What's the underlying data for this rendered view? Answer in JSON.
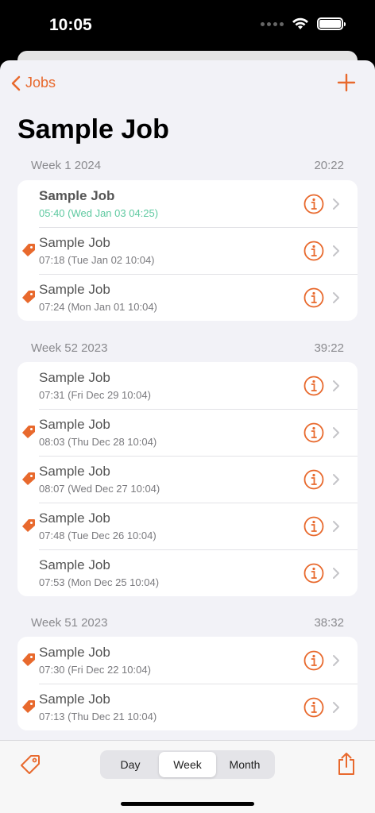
{
  "status": {
    "time": "10:05"
  },
  "nav": {
    "back_label": "Jobs",
    "title": "Sample Job"
  },
  "colors": {
    "accent": "#e8692d",
    "running": "#5ec9a0"
  },
  "sections": [
    {
      "header": "Week 1 2024",
      "total": "20:22",
      "rows": [
        {
          "title": "Sample Job",
          "subtitle": "05:40 (Wed Jan 03 04:25)",
          "tagged": false,
          "running": true
        },
        {
          "title": "Sample Job",
          "subtitle": "07:18 (Tue Jan 02 10:04)",
          "tagged": true,
          "running": false
        },
        {
          "title": "Sample Job",
          "subtitle": "07:24 (Mon Jan 01 10:04)",
          "tagged": true,
          "running": false
        }
      ]
    },
    {
      "header": "Week 52 2023",
      "total": "39:22",
      "rows": [
        {
          "title": "Sample Job",
          "subtitle": "07:31 (Fri Dec 29 10:04)",
          "tagged": false,
          "running": false
        },
        {
          "title": "Sample Job",
          "subtitle": "08:03 (Thu Dec 28 10:04)",
          "tagged": true,
          "running": false
        },
        {
          "title": "Sample Job",
          "subtitle": "08:07 (Wed Dec 27 10:04)",
          "tagged": true,
          "running": false
        },
        {
          "title": "Sample Job",
          "subtitle": "07:48 (Tue Dec 26 10:04)",
          "tagged": true,
          "running": false
        },
        {
          "title": "Sample Job",
          "subtitle": "07:53 (Mon Dec 25 10:04)",
          "tagged": false,
          "running": false
        }
      ]
    },
    {
      "header": "Week 51 2023",
      "total": "38:32",
      "rows": [
        {
          "title": "Sample Job",
          "subtitle": "07:30 (Fri Dec 22 10:04)",
          "tagged": true,
          "running": false
        },
        {
          "title": "Sample Job",
          "subtitle": "07:13 (Thu Dec 21 10:04)",
          "tagged": true,
          "running": false
        }
      ]
    }
  ],
  "toolbar": {
    "segments": [
      "Day",
      "Week",
      "Month"
    ],
    "selected": "Week"
  }
}
